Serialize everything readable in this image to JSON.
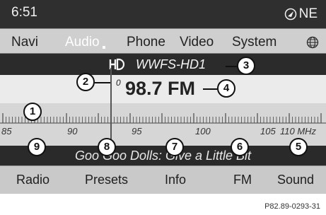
{
  "status": {
    "time": "6:51",
    "heading": "NE"
  },
  "menu": {
    "items": [
      {
        "label": "Navi",
        "active": false
      },
      {
        "label": "Audio",
        "active": true
      },
      {
        "label": "Phone",
        "active": false
      },
      {
        "label": "Video",
        "active": false
      },
      {
        "label": "System",
        "active": false
      }
    ]
  },
  "station": {
    "name": "WWFS-HD1"
  },
  "tuner": {
    "preset": "0",
    "frequency": "98.7 FM"
  },
  "scale": {
    "labels": [
      "85",
      "90",
      "95",
      "100",
      "105",
      "110 MHz"
    ]
  },
  "now_playing": {
    "text": "Goo Goo Dolls: Give a Little Bit"
  },
  "softkeys": [
    "Radio",
    "Presets",
    "Info",
    "FM",
    "Sound"
  ],
  "callouts": [
    "1",
    "2",
    "3",
    "4",
    "5",
    "6",
    "7",
    "8",
    "9"
  ],
  "footer": {
    "code": "P82.89-0293-31"
  },
  "colors": {
    "status_bg": "#2f2f2f",
    "menu_bg": "#cfcfcf",
    "band_bg": "#2b2b2b",
    "accent_text": "#ffffff"
  },
  "icons": {
    "compass": "compass-icon",
    "globe": "globe-icon",
    "hd": "hd-radio-icon"
  }
}
